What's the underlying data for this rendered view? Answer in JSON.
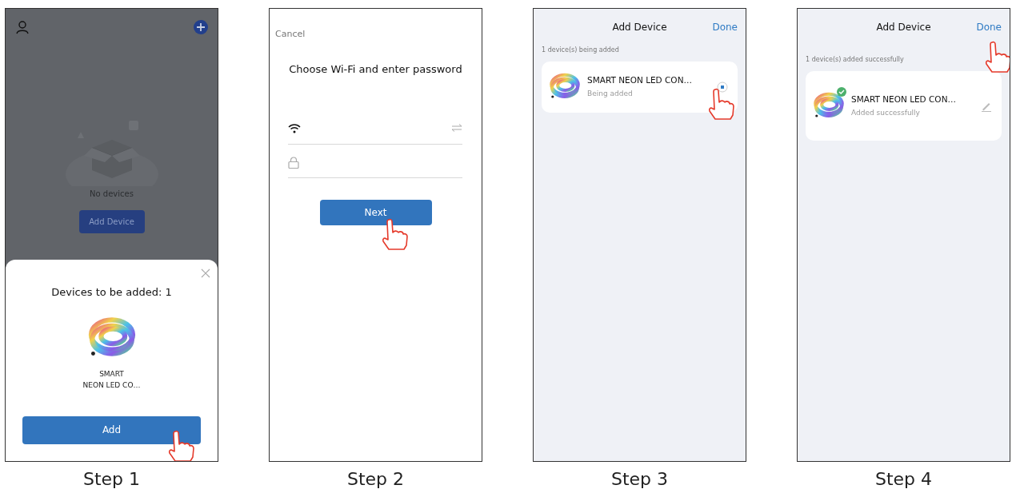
{
  "steps": [
    {
      "kind": "home_sheet",
      "caption": "Step 1",
      "empty_text": "No devices",
      "add_device": {
        "label": "Add Device"
      },
      "sheet": {
        "title": "Devices to be added: 1",
        "device_lines": [
          "SMART",
          "NEON LED CO…"
        ],
        "button": {
          "label": "Add",
          "pointed": true
        }
      }
    },
    {
      "kind": "wifi",
      "caption": "Step 2",
      "cancel": "Cancel",
      "title": "Choose Wi-Fi and enter password",
      "button": {
        "label": "Next",
        "pointed": true
      }
    },
    {
      "kind": "device_list",
      "caption": "Step 3",
      "title": "Add Device",
      "done": {
        "label": "Done",
        "pointed": false
      },
      "status": "1 device(s) being added",
      "device": {
        "name": "SMART NEON LED CON…",
        "status": "Being added",
        "added": false,
        "pointed": true
      }
    },
    {
      "kind": "device_list",
      "caption": "Step 4",
      "title": "Add Device",
      "done": {
        "label": "Done",
        "pointed": true
      },
      "status": "1 device(s) added successfully",
      "device": {
        "name": "SMART NEON LED CON…",
        "status": "Added successfully",
        "added": true,
        "pointed": false
      }
    }
  ]
}
